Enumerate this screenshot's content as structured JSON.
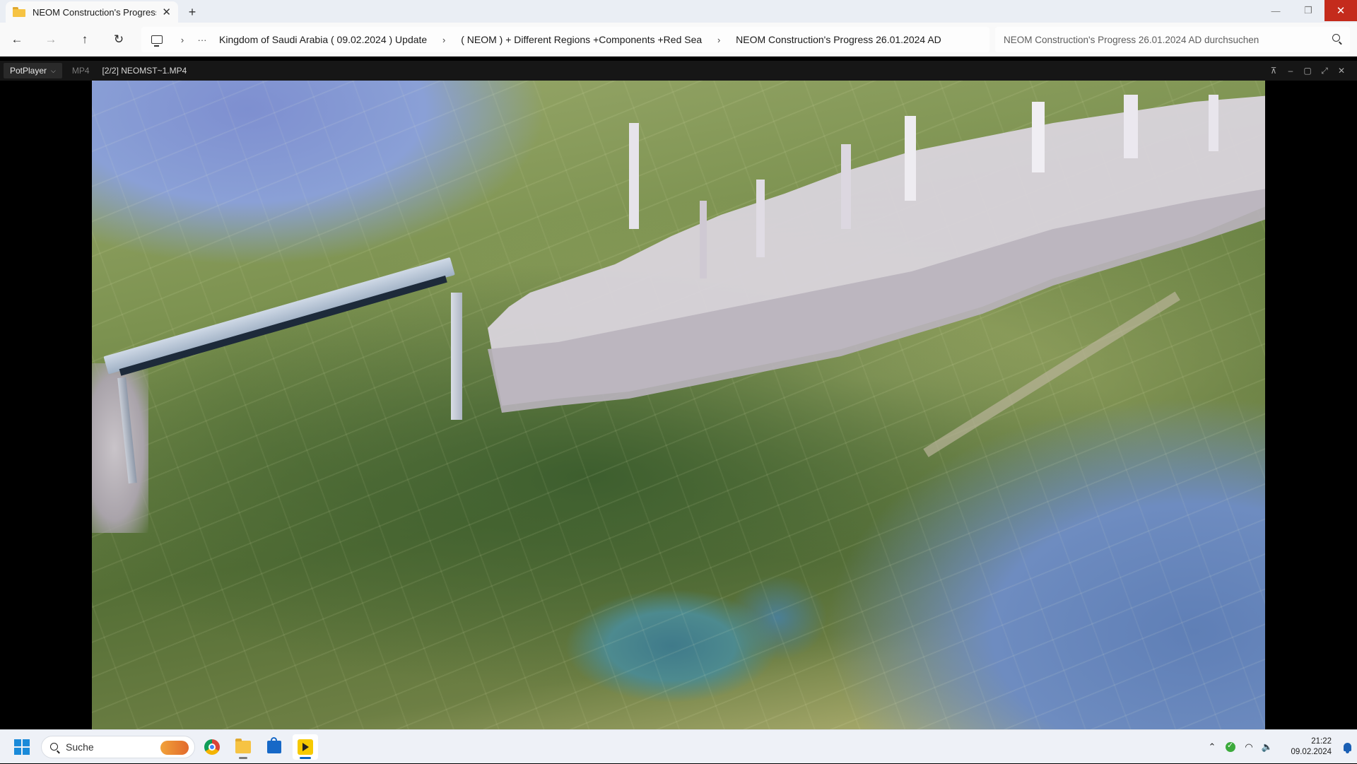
{
  "explorer": {
    "tab_title": "NEOM Construction's Progress",
    "tab_close": "✕",
    "new_tab": "+",
    "window_controls": {
      "minimize": "—",
      "restore": "❐",
      "close": "✕"
    },
    "nav": {
      "back": "←",
      "forward": "→",
      "up": "↑",
      "refresh": "↻",
      "more": "···"
    },
    "breadcrumbs": [
      "Kingdom of Saudi Arabia ( 09.02.2024 ) Update",
      "( NEOM ) + Different Regions +Components +Red Sea",
      "NEOM Construction's Progress 26.01.2024 AD"
    ],
    "breadcrumb_separator": "›",
    "search_placeholder": "NEOM Construction's Progress 26.01.2024 AD durchsuchen"
  },
  "player": {
    "brand": "PotPlayer",
    "brand_caret": "⌵",
    "format": "MP4",
    "file": "[2/2] NEOMST~1.MP4",
    "controls": {
      "pin": "⊼",
      "minimize": "–",
      "maximize": "▢",
      "fullscreen": "⤢",
      "close": "✕"
    }
  },
  "taskbar": {
    "search_placeholder": "Suche",
    "apps": [
      "chrome-icon",
      "file-explorer-icon",
      "microsoft-store-icon",
      "potplayer-icon"
    ],
    "tray": {
      "chevron": "⌃",
      "wifi": "◠",
      "volume": "🔈"
    },
    "time": "21:22",
    "date": "09.02.2024"
  },
  "colors": {
    "close_red": "#c42b1c",
    "accent_blue": "#0a64c0",
    "player_bar": "#161616"
  }
}
